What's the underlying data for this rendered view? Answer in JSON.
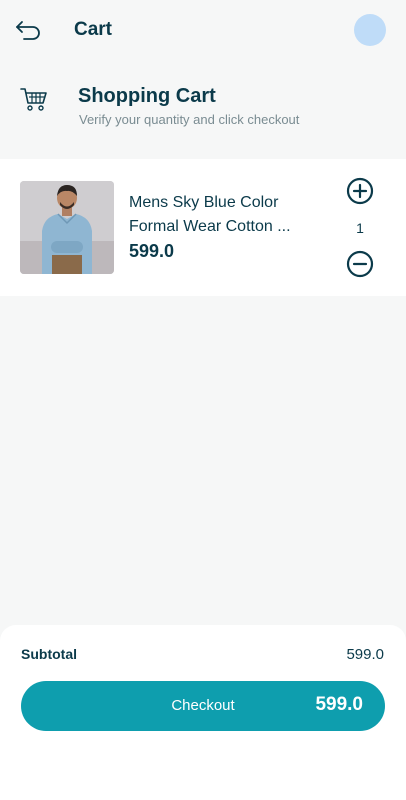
{
  "appbar": {
    "title": "Cart",
    "back_icon": "back-arrow-icon",
    "avatar_color": "#bfdcf8"
  },
  "header": {
    "icon": "shopping-cart-icon",
    "title": "Shopping Cart",
    "subtitle": "Verify your quantity and click checkout"
  },
  "cart": {
    "items": [
      {
        "name_line1": "Mens Sky Blue Color",
        "name_line2": "Formal  Wear Cotton ...",
        "price": "599.0",
        "quantity": "1"
      }
    ]
  },
  "summary": {
    "subtotal_label": "Subtotal",
    "subtotal_value": "599.0",
    "checkout_label": "Checkout",
    "checkout_total": "599.0"
  },
  "colors": {
    "accent": "#0e9eae",
    "text_dark": "#0b3a4a",
    "background": "#f6f7f7"
  }
}
